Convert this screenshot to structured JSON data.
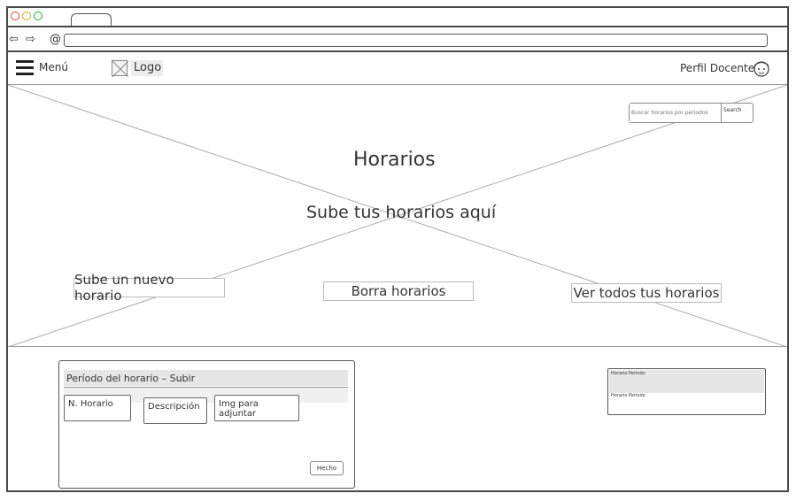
{
  "browser": {
    "window_dots": [
      {
        "name": "close",
        "color": "#e0443e"
      },
      {
        "name": "minimize",
        "color": "#dea123"
      },
      {
        "name": "maximize",
        "color": "#1aab29"
      }
    ]
  },
  "navbar": {
    "menu_label": "Menú",
    "logo_label": "Logo",
    "profile_label": "Perfil Docente"
  },
  "hero": {
    "search_placeholder": "Buscar horarios por periodos",
    "search_button": "Search",
    "title": "Horarios",
    "subtitle": "Sube tus horarios aquí",
    "actions": {
      "upload": "Sube un nuevo horario",
      "delete": "Borra horarios",
      "view_all": "Ver todos tus horarios"
    }
  },
  "upload_card": {
    "header": "Período del horario – Subir",
    "fields": {
      "number": "N. Horario",
      "description": "Descripción",
      "image": "Img para adjuntar"
    },
    "done_button": "Hecho"
  },
  "period_list": {
    "items": [
      "Horario Periodo",
      "Horario Periodo"
    ]
  }
}
